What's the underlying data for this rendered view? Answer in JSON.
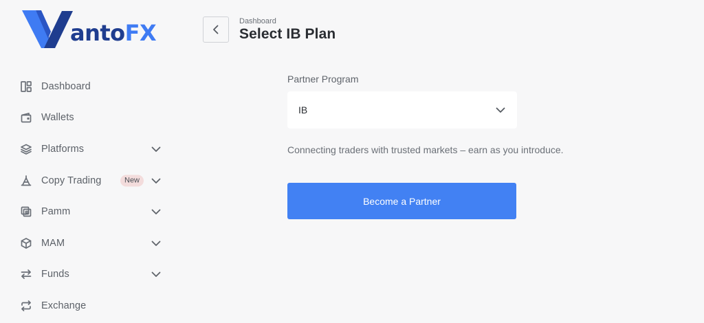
{
  "brand": {
    "text_primary": "anto",
    "text_accent": "FX",
    "color_dark": "#1f3d8f",
    "color_accent": "#3f7bf3"
  },
  "sidebar": {
    "items": [
      {
        "label": "Dashboard",
        "icon": "layout-icon"
      },
      {
        "label": "Wallets",
        "icon": "wallet-icon"
      },
      {
        "label": "Platforms",
        "icon": "layers-icon",
        "has_chevron": true
      },
      {
        "label": "Copy Trading",
        "icon": "copy-trading-icon",
        "has_chevron": true,
        "badge": "New"
      },
      {
        "label": "Pamm",
        "icon": "pamm-icon",
        "has_chevron": true
      },
      {
        "label": "MAM",
        "icon": "cube-icon",
        "has_chevron": true
      },
      {
        "label": "Funds",
        "icon": "transfer-icon",
        "has_chevron": true
      },
      {
        "label": "Exchange",
        "icon": "exchange-icon"
      }
    ]
  },
  "header": {
    "breadcrumb": "Dashboard",
    "title": "Select IB Plan"
  },
  "main": {
    "field_label": "Partner Program",
    "select_value": "IB",
    "tagline": "Connecting traders with trusted markets – earn as you introduce.",
    "cta_label": "Become a Partner",
    "cta_color": "#4281f3"
  }
}
